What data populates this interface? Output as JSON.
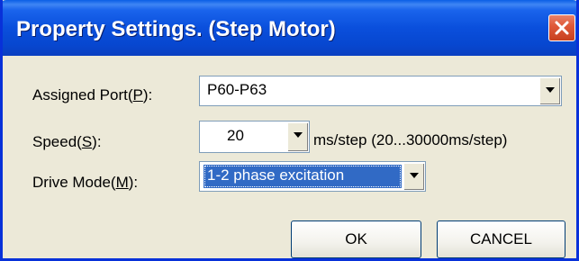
{
  "window": {
    "title": "Property Settings. (Step Motor)",
    "close_icon": "close-icon"
  },
  "fields": {
    "assigned_port": {
      "label_pre": "Assigned Port(",
      "label_key": "P",
      "label_post": "):",
      "value": "P60-P63"
    },
    "speed": {
      "label_pre": "Speed(",
      "label_key": "S",
      "label_post": "):",
      "value": "20",
      "unit": "ms/step  (20...30000ms/step)"
    },
    "drive_mode": {
      "label_pre": "Drive Mode(",
      "label_key": "M",
      "label_post": "):",
      "value": "1-2 phase excitation"
    }
  },
  "buttons": {
    "ok": "OK",
    "cancel": "CANCEL"
  },
  "colors": {
    "title_bar": "#0a4fdc",
    "selection": "#316ac5",
    "close_button": "#e05a3a"
  }
}
